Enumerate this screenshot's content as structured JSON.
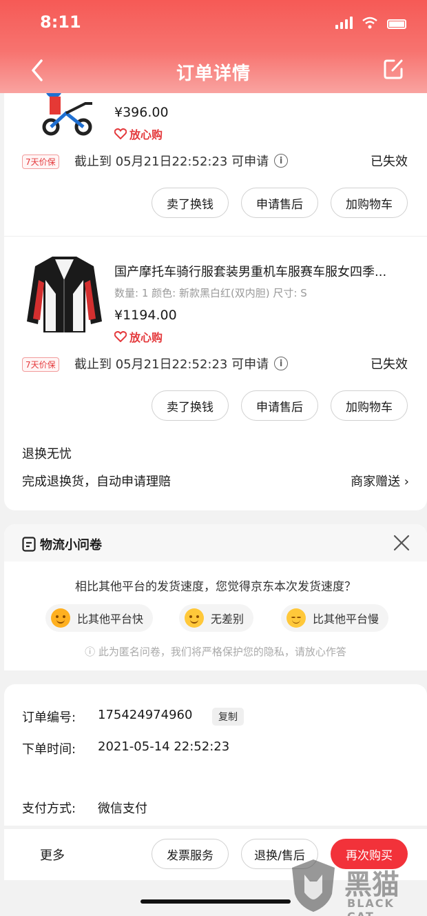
{
  "status_bar": {
    "time": "8:11"
  },
  "nav": {
    "title": "订单详情"
  },
  "products": [
    {
      "price": "¥396.00",
      "guarantee": "放心购",
      "badge": "7天价保",
      "deadline": "截止到 05月21日22:52:23 可申请",
      "status": "已失效",
      "buttons": [
        "卖了换钱",
        "申请售后",
        "加购物车"
      ]
    },
    {
      "title": "国产摩托车骑行服套装男重机车服赛车服女四季...",
      "spec": "数量: 1  颜色: 新款黑白红(双内胆)  尺寸: S",
      "price": "¥1194.00",
      "guarantee": "放心购",
      "badge": "7天价保",
      "deadline": "截止到 05月21日22:52:23 可申请",
      "status": "已失效",
      "buttons": [
        "卖了换钱",
        "申请售后",
        "加购物车"
      ]
    }
  ],
  "worry_free": {
    "title": "退换无忧",
    "desc": "完成退换货，自动申请理赔",
    "gift": "商家赠送 ›"
  },
  "survey": {
    "title": "物流小问卷",
    "question": "相比其他平台的发货速度，您觉得京东本次发货速度？",
    "options": [
      "比其他平台快",
      "无差别",
      "比其他平台慢"
    ],
    "note": "ⓘ 此为匿名问卷，我们将严格保护您的隐私，请放心作答"
  },
  "order": {
    "number_label": "订单编号:",
    "number": "175424974960",
    "copy": "复制",
    "time_label": "下单时间:",
    "time": "2021-05-14 22:52:23",
    "payment_label": "支付方式:",
    "payment": "微信支付"
  },
  "bottom": {
    "more": "更多",
    "invoice": "发票服务",
    "return": "退换/售后",
    "rebuy": "再次购买"
  },
  "watermark": {
    "text": "黑猫",
    "sub": "BLACK CAT"
  },
  "colors": {
    "accent": "#e4393c",
    "header": "#f65a56",
    "rebuy": "#f2323a"
  }
}
